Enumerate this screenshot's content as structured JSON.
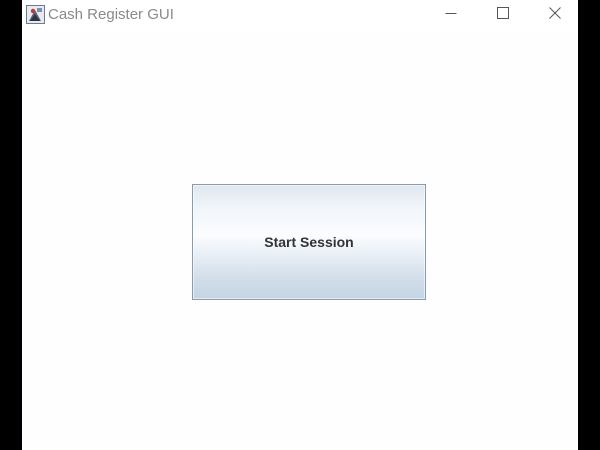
{
  "window": {
    "title": "Cash Register GUI",
    "icon": "java-cup-icon"
  },
  "titlebar_controls": {
    "minimize_icon": "minimize-icon",
    "maximize_icon": "maximize-icon",
    "close_icon": "close-icon"
  },
  "main": {
    "start_button_label": "Start Session"
  },
  "colors": {
    "window_background": "#fefdff",
    "button_border": "#8a9bae",
    "button_text": "#333333",
    "title_text": "#8a8a8a"
  }
}
